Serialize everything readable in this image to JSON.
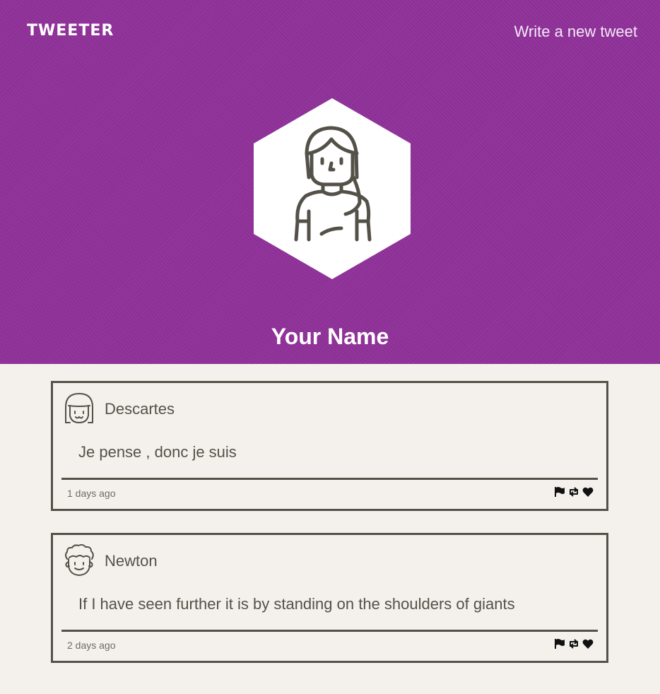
{
  "nav": {
    "brand": "TWEETER",
    "compose_link": "Write a new tweet"
  },
  "profile": {
    "name": "Your Name"
  },
  "tweets": [
    {
      "author": "Descartes",
      "text": "Je pense , donc je suis",
      "time": "1 days ago",
      "avatar_icon": "girl-avatar-icon"
    },
    {
      "author": "Newton",
      "text": "If I have seen further it is by standing on the shoulders of giants",
      "time": "2 days ago",
      "avatar_icon": "curly-hair-avatar-icon"
    }
  ],
  "actions": [
    "flag-icon",
    "retweet-icon",
    "heart-icon"
  ],
  "colors": {
    "header_bg": "#8e2b99",
    "page_bg": "#f4f1ec",
    "ink": "#545149",
    "white": "#ffffff"
  }
}
